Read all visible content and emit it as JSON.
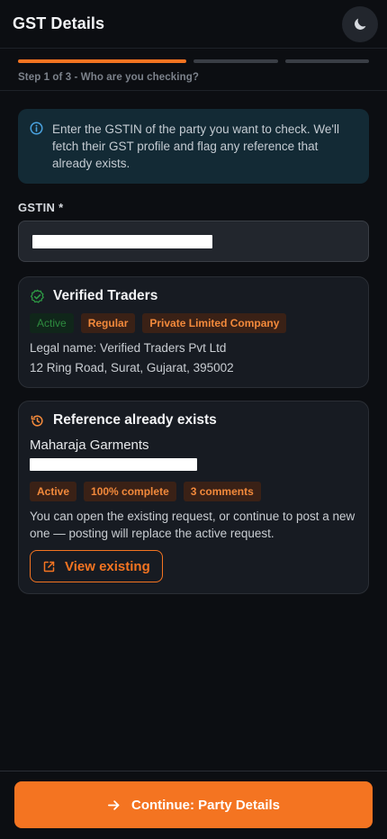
{
  "header": {
    "title": "GST Details",
    "theme_icon": "moon-icon"
  },
  "stepper": {
    "current": 1,
    "total": 3,
    "label": "Step 1 of 3 - Who are you checking?"
  },
  "info": {
    "text": "Enter the GSTIN of the party you want to check. We'll fetch their GST profile and flag any reference that already exists."
  },
  "gstin": {
    "label": "GSTIN *",
    "value_redacted": true
  },
  "verified": {
    "title": "Verified Traders",
    "badges": [
      "Active",
      "Regular",
      "Private Limited Company"
    ],
    "legal_name": "Legal name: Verified Traders Pvt Ltd",
    "address": "12 Ring Road, Surat, Gujarat, 395002"
  },
  "reference": {
    "title": "Reference already exists",
    "party": "Maharaja Garments",
    "badges": [
      "Active",
      "100% complete",
      "3 comments"
    ],
    "message": "You can open the existing request, or continue to post a new one — posting will replace the active request.",
    "button_label": "View existing"
  },
  "footer": {
    "continue_label": "Continue: Party Details"
  },
  "colors": {
    "accent": "#f47421",
    "success": "#2e8b3f",
    "info": "#4aa3e0"
  }
}
